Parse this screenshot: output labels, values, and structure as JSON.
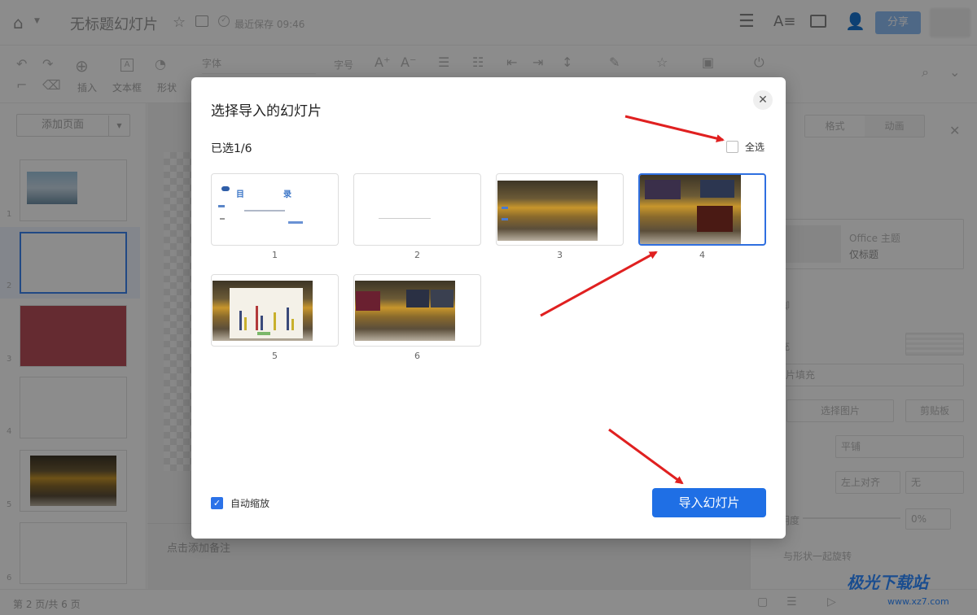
{
  "header": {
    "doc_title": "无标题幻灯片",
    "save_status": "最近保存 09:46",
    "share_label": "分享"
  },
  "toolbar": {
    "insert_label": "插入",
    "textbox_label": "文本框",
    "shape_label": "形状",
    "font_placeholder": "字体",
    "fontsize_placeholder": "字号"
  },
  "sidebar": {
    "add_page_label": "添加页面",
    "page_numbers": [
      "1",
      "2",
      "3",
      "4",
      "5",
      "6"
    ]
  },
  "canvas": {
    "notes_placeholder": "点击添加备注"
  },
  "right_panel": {
    "tabs": [
      "格式",
      "动画"
    ],
    "theme_name": "Office 主题",
    "theme_layout": "仅标题",
    "footer_label": "页脚",
    "fill_label": "填充",
    "fill_mode": "图片填充",
    "choose_image": "选择图片",
    "clipboard": "剪贴板",
    "tile_mode": "平铺",
    "align_mode": "左上对齐",
    "mirror_mode": "无",
    "transparency_label": "透明度",
    "transparency_value": "0%",
    "rotate_with_shape": "与形状一起旋转"
  },
  "statusbar": {
    "page_info": "第 2 页/共 6 页"
  },
  "dialog": {
    "title": "选择导入的幻灯片",
    "selected_count": "已选1/6",
    "select_all_label": "全选",
    "slides": [
      {
        "number": "1",
        "selected": false,
        "title_left": "目",
        "title_right": "录"
      },
      {
        "number": "2",
        "selected": false
      },
      {
        "number": "3",
        "selected": false
      },
      {
        "number": "4",
        "selected": true
      },
      {
        "number": "5",
        "selected": false
      },
      {
        "number": "6",
        "selected": false
      }
    ],
    "auto_zoom_label": "自动缩放",
    "auto_zoom_checked": true,
    "import_button_label": "导入幻灯片"
  },
  "watermark": {
    "text": "极光下载站",
    "url": "www.xz7.com"
  },
  "colors": {
    "primary": "#1f6fe5",
    "annotation_arrow": "#e02020"
  }
}
